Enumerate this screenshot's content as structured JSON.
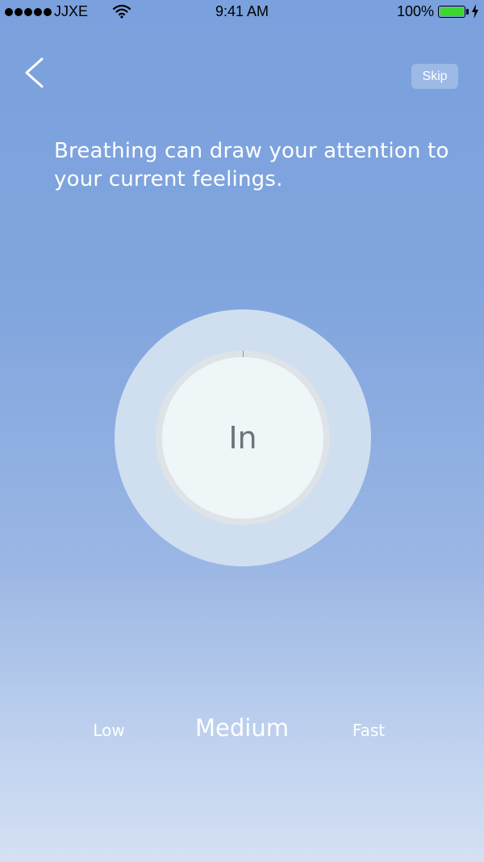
{
  "status_bar": {
    "carrier": "JJXE",
    "time": "9:41 AM",
    "battery_percent": "100%",
    "battery_level": 1.0,
    "battery_color": "#3ad82a",
    "signal_bars": 5,
    "wifi_icon": "wifi-icon",
    "charging_icon": "charging-bolt-icon"
  },
  "nav": {
    "back_icon": "chevron-left-icon",
    "skip_label": "Skip"
  },
  "message": "Breathing can draw your attention to your current feelings.",
  "breathing": {
    "phase_label": "In",
    "progress": 0.0
  },
  "speed_selector": {
    "options": [
      "Low",
      "Medium",
      "Fast"
    ],
    "selected": "Medium"
  },
  "colors": {
    "background_top": "#7aa1dd",
    "background_bottom": "#d5e1f3",
    "outer_ring": "#cfdff0",
    "inner_circle": "#eef6f8",
    "phase_text": "#6e7478"
  }
}
